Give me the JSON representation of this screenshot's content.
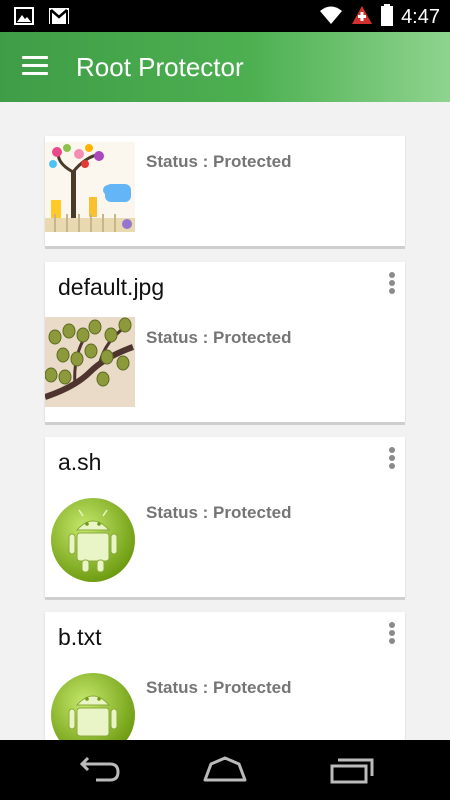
{
  "status_bar": {
    "time": "4:47",
    "icons": [
      "image-notification-icon",
      "gmail-icon",
      "wifi-icon",
      "warning-icon",
      "battery-icon"
    ]
  },
  "app_bar": {
    "title": "Root Protector",
    "menu_icon": "hamburger-menu-icon"
  },
  "files": [
    {
      "name": "",
      "status": "Status : Protected",
      "thumbnail": "nursery-tree-art"
    },
    {
      "name": "default.jpg",
      "status": "Status : Protected",
      "thumbnail": "tree-branch-art"
    },
    {
      "name": "a.sh",
      "status": "Status : Protected",
      "thumbnail": "android-icon"
    },
    {
      "name": "b.txt",
      "status": "Status : Protected",
      "thumbnail": "android-icon"
    }
  ],
  "nav_bar": {
    "buttons": [
      "back-icon",
      "home-icon",
      "recents-icon"
    ]
  },
  "colors": {
    "app_bar_start": "#3f9d47",
    "app_bar_end": "#8ed48f",
    "status_text": "#757575",
    "background": "#f2f2f2"
  }
}
